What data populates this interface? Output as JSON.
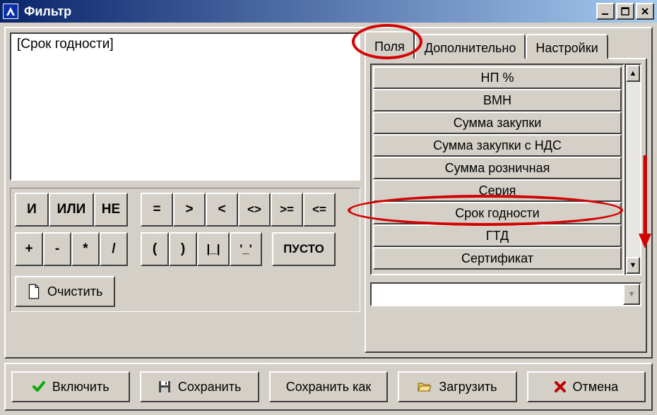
{
  "window": {
    "title": "Фильтр"
  },
  "expression": "[Срок годности]",
  "logic": {
    "and": "И",
    "or": "ИЛИ",
    "not": "НЕ"
  },
  "comp": {
    "eq": "=",
    "gt": ">",
    "lt": "<",
    "ne": "<>",
    "ge": ">=",
    "le": "<="
  },
  "arith": {
    "plus": "+",
    "minus": "-",
    "mul": "*",
    "div": "/",
    "lp": "(",
    "rp": ")",
    "q1": "|_|",
    "q2": "'_'",
    "empty": "ПУСТО"
  },
  "clear_label": "Очистить",
  "tabs": {
    "fields": "Поля",
    "extra": "Дополнительно",
    "settings": "Настройки"
  },
  "fields": [
    "НП %",
    "ВМН",
    "Сумма закупки",
    "Сумма закупки с НДС",
    "Сумма розничная",
    "Серия",
    "Срок годности",
    "ГТД",
    "Сертификат"
  ],
  "combo_value": "",
  "bottom": {
    "enable": "Включить",
    "save": "Сохранить",
    "save_as": "Сохранить как",
    "load": "Загрузить",
    "cancel": "Отмена"
  }
}
